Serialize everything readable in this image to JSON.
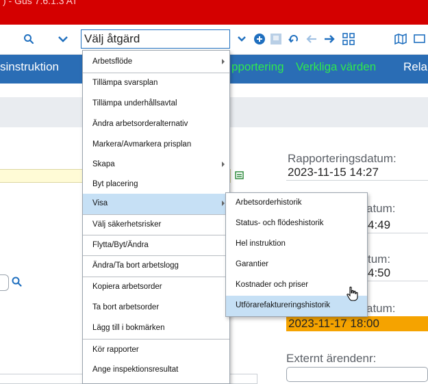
{
  "window": {
    "title": ") - Gus 7.6.1.3 AT"
  },
  "toolbar": {
    "action_select_value": "Välj åtgärd",
    "icons": [
      "search-icon",
      "chevron-down-icon",
      "chevron-down-icon",
      "add-circle-icon",
      "save-icon",
      "undo-icon",
      "back-arrow-icon",
      "forward-arrow-icon",
      "workflow-icon",
      "map-icon",
      "screen-icon"
    ]
  },
  "tabs": [
    {
      "label": "sinstruktion",
      "color": "#ffffff"
    },
    {
      "label": "pportering",
      "color": "#2fe84e"
    },
    {
      "label": "Verkliga värden",
      "color": "#2fe84e"
    },
    {
      "label": "Rela",
      "color": "#ffffff"
    }
  ],
  "fields": {
    "rapporteringsdatum": {
      "label": "Rapporteringsdatum:",
      "value": "2023-11-15 14:27"
    },
    "field2": {
      "label": "atum:",
      "value": "4:49"
    },
    "field3": {
      "label": "tum:",
      "value": "4:50"
    },
    "field4": {
      "label": "atum:",
      "value": "2023-11-17 18:00"
    },
    "externt": {
      "label": "Externt ärendenr:",
      "value": ""
    }
  },
  "menu": {
    "items": [
      {
        "label": "Arbetsflöde",
        "submenu": true
      },
      {
        "label": "Tillämpa svarsplan"
      },
      {
        "label": "Tillämpa underhållsavtal"
      },
      {
        "label": "Ändra arbetsorderalternativ"
      },
      {
        "label": "Markera/Avmarkera prisplan"
      },
      {
        "label": "Skapa",
        "submenu": true
      },
      {
        "label": "Byt placering"
      },
      {
        "label": "Visa",
        "submenu": true,
        "highlighted": true
      },
      {
        "label": "Välj säkerhetsrisker"
      },
      {
        "label": "Flytta/Byt/Ändra"
      },
      {
        "label": "Ändra/Ta bort arbetslogg"
      },
      {
        "label": "Kopiera arbetsorder"
      },
      {
        "label": "Ta bort arbetsorder"
      },
      {
        "label": "Lägg till i bokmärken"
      },
      {
        "label": "Kör rapporter"
      },
      {
        "label": "Ange inspektionsresultat"
      }
    ]
  },
  "submenu": {
    "items": [
      {
        "label": "Arbetsorderhistorik"
      },
      {
        "label": "Status- och flödeshistorik"
      },
      {
        "label": "Hel instruktion"
      },
      {
        "label": "Garantier"
      },
      {
        "label": "Kostnader och priser"
      },
      {
        "label": "Utförarefaktureringshistorik",
        "highlighted": true
      }
    ]
  },
  "colors": {
    "title_bar": "#d40000",
    "tab_bar": "#2a6db5",
    "menu_highlight": "#c6e0f5",
    "date_highlight": "#f5a300",
    "accent_blue": "#1f6fbf"
  }
}
